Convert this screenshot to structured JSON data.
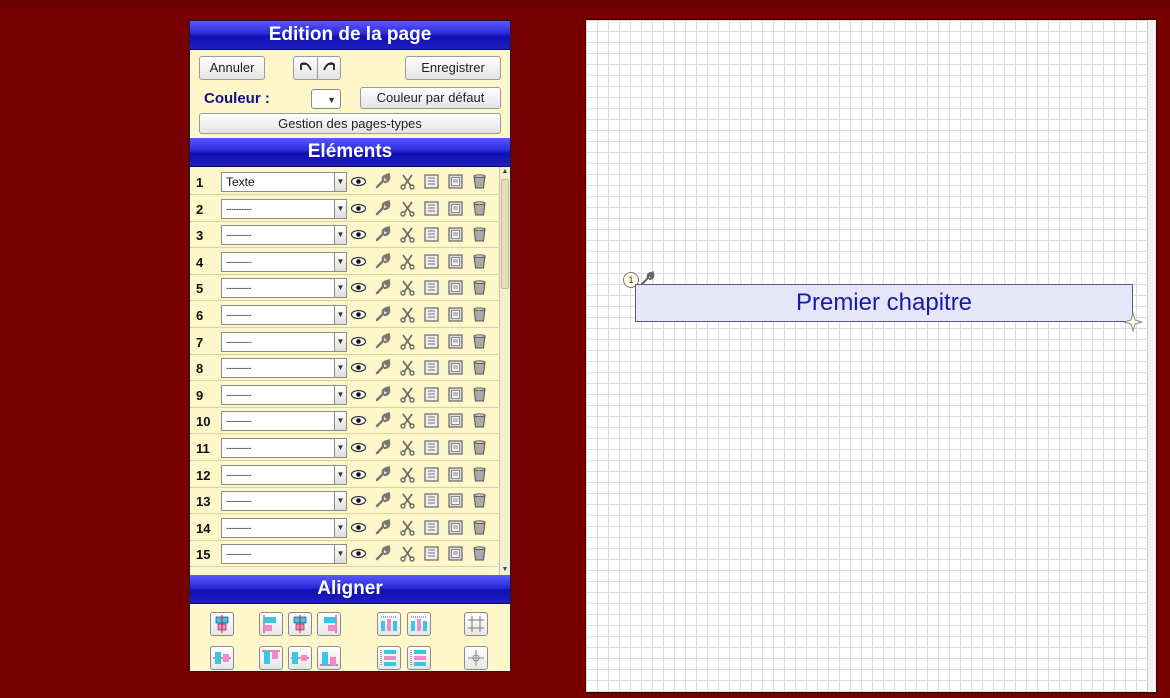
{
  "editor": {
    "title": "Edition de la page",
    "cancel_label": "Annuler",
    "undo_icon": "undo-arrow-icon",
    "redo_icon": "redo-arrow-icon",
    "save_label": "Enregistrer",
    "color_label": "Couleur :",
    "default_color_label": "Couleur par défaut",
    "page_types_label": "Gestion des pages-types"
  },
  "elements": {
    "title": "Eléments",
    "rows": [
      {
        "num": "1",
        "value": "Texte"
      },
      {
        "num": "2",
        "value": "----------"
      },
      {
        "num": "3",
        "value": "----------"
      },
      {
        "num": "4",
        "value": "----------"
      },
      {
        "num": "5",
        "value": "----------"
      },
      {
        "num": "6",
        "value": "----------"
      },
      {
        "num": "7",
        "value": "----------"
      },
      {
        "num": "8",
        "value": "----------"
      },
      {
        "num": "9",
        "value": "----------"
      },
      {
        "num": "10",
        "value": "----------"
      },
      {
        "num": "11",
        "value": "----------"
      },
      {
        "num": "12",
        "value": "----------"
      },
      {
        "num": "13",
        "value": "----------"
      },
      {
        "num": "14",
        "value": "----------"
      },
      {
        "num": "15",
        "value": "----------"
      }
    ],
    "row_icons": [
      "eye-icon",
      "wrench-icon",
      "scissors-icon",
      "copy-icon",
      "paste-icon",
      "trash-icon"
    ]
  },
  "align": {
    "title": "Aligner",
    "buttons_row1": [
      "align-top-icon",
      "align-left-icon",
      "align-center-h-icon",
      "align-right-icon",
      "distribute-h-icon",
      "distribute-h-alt-icon",
      "grid-icon"
    ],
    "buttons_row2": [
      "align-middle-icon",
      "align-top-left-icon",
      "align-center-v-icon",
      "align-bottom-icon",
      "distribute-v-icon",
      "distribute-v-alt-icon",
      "crosshair-icon"
    ]
  },
  "canvas": {
    "element_badge": "1",
    "title_text": "Premier chapitre"
  },
  "colors": {
    "background": "#7a0000",
    "header_blue": "#2a2ad8",
    "panel_bg": "#fdf7c9",
    "title_text": "#1a1aa8"
  }
}
